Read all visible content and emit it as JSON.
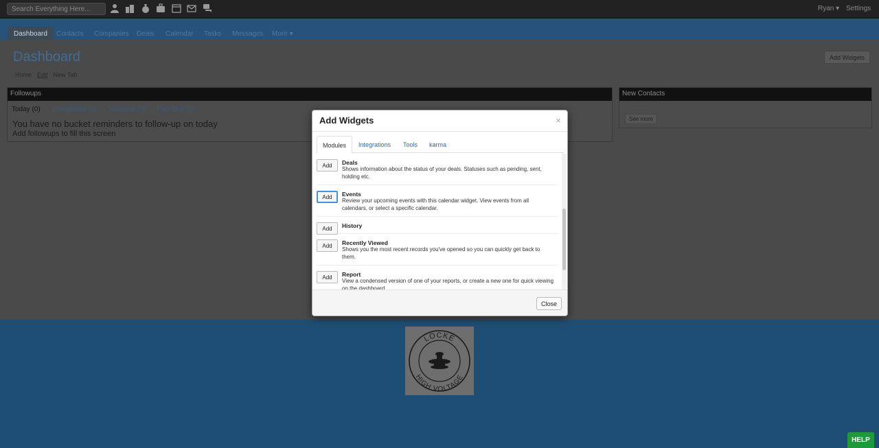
{
  "topbar": {
    "search_placeholder": "Search Everything Here...",
    "quick_icons": [
      "user-icon",
      "building-icon",
      "money-bag-icon",
      "briefcase-icon",
      "calendar-icon",
      "envelope-icon",
      "chat-icon"
    ],
    "user_menu": "Ryan",
    "settings": "Settings"
  },
  "nav": {
    "tabs": [
      "Dashboard",
      "Contacts",
      "Companies",
      "Deals",
      "Calendar",
      "Tasks",
      "Messages",
      "More"
    ],
    "active": "Dashboard"
  },
  "page": {
    "title": "Dashboard",
    "breadcrumb": [
      "Home",
      "Edit",
      "New Tab"
    ],
    "add_widgets_button": "Add Widgets"
  },
  "followups": {
    "title": "Followups",
    "tabs": [
      "Today (0)",
      "Completed (0)",
      "Snoozed (0)",
      "Past Due (0)"
    ],
    "message": "You have no bucket reminders to follow-up on today",
    "submessage": "Add followups to fill this screen"
  },
  "new_contacts": {
    "title": "New Contacts",
    "see_more": "See more"
  },
  "modal": {
    "title": "Add Widgets",
    "close_symbol": "×",
    "tabs": [
      "Modules",
      "Integrations",
      "Tools",
      "karma"
    ],
    "active_tab": "Modules",
    "add_label": "Add",
    "items": [
      {
        "name": "Deals",
        "desc": "Shows information about the status of your deals. Statuses such as pending, sent, holding etc."
      },
      {
        "name": "Events",
        "desc": "Review your upcoming events with this calendar widget. View events from all calendars, or select a specific calendar."
      },
      {
        "name": "History",
        "desc": ""
      },
      {
        "name": "Recently Viewed",
        "desc": "Shows you the most recent records you've opened so you can quickly get back to them."
      },
      {
        "name": "Report",
        "desc": "View a condensed version of one of your reports, or create a new one for quick viewing on the dashboard."
      }
    ],
    "close_button": "Close"
  },
  "logo": {
    "text_top": "LOCKE",
    "text_bottom": "HIGH VOLTAGE"
  },
  "help_button": "HELP",
  "colors": {
    "dashboard_title": "#3f6d99",
    "help_green": "#1e9a3c",
    "link_blue": "#2a6bb0",
    "focus_blue": "#4a90d9"
  }
}
